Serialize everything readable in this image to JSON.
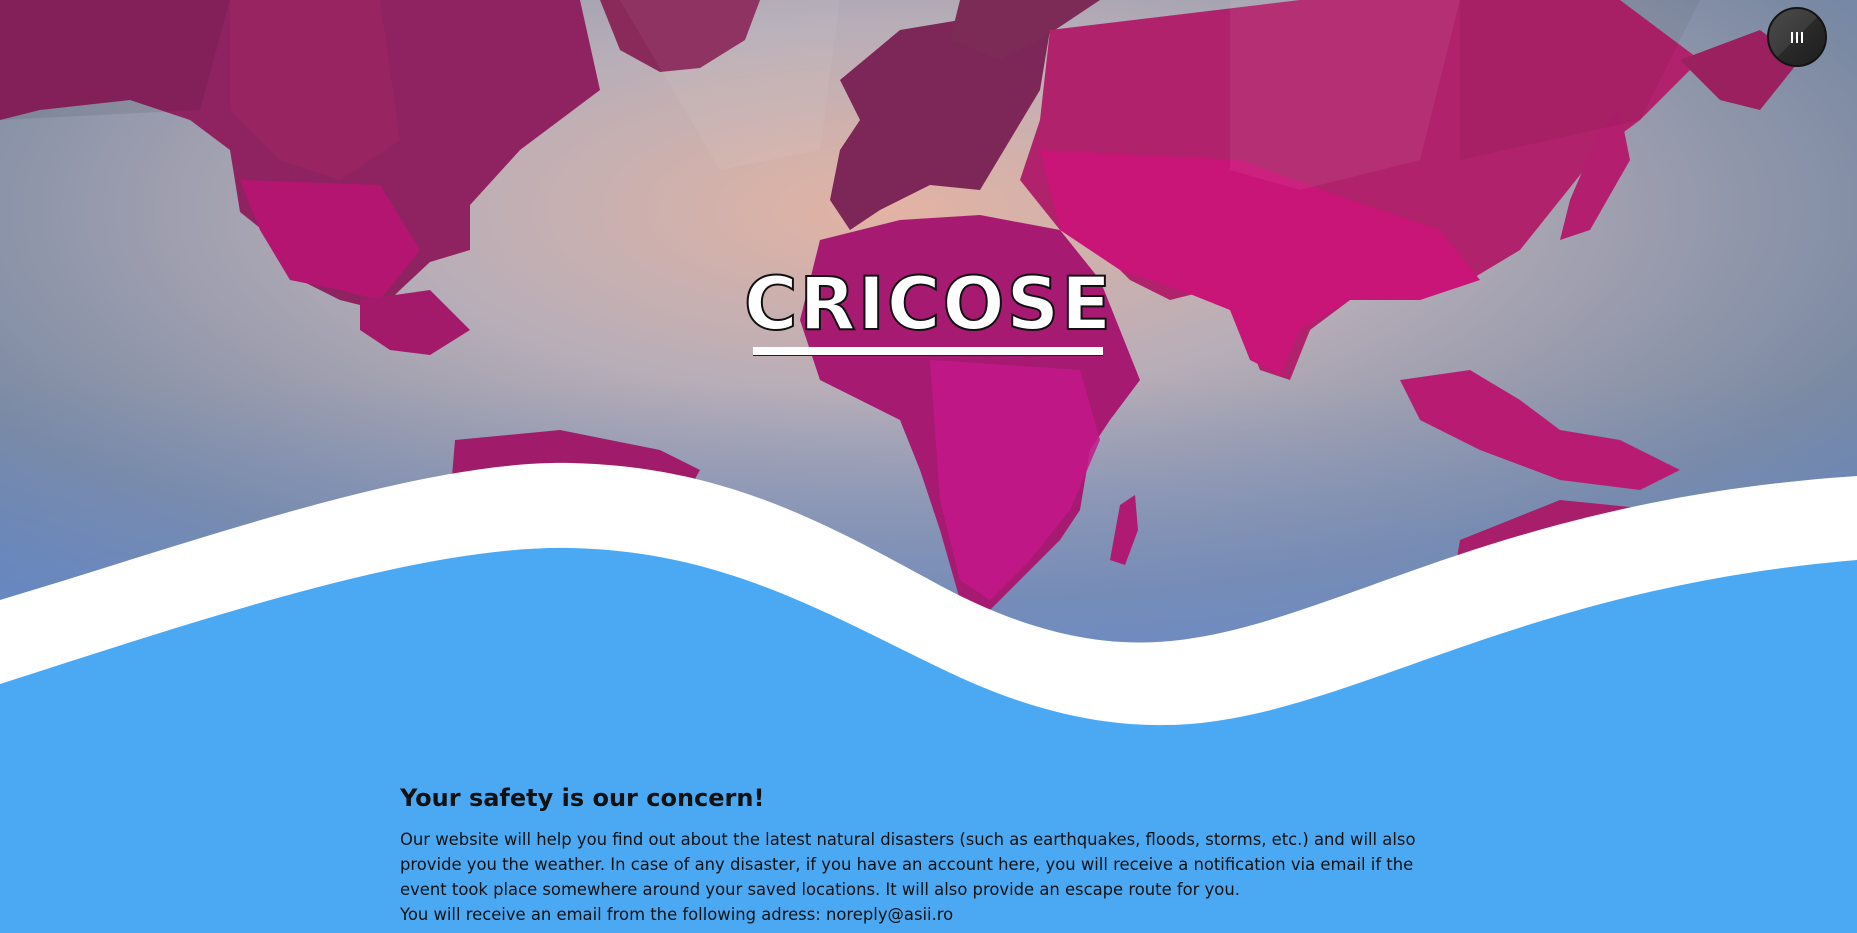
{
  "hero": {
    "title": "CRICOSE"
  },
  "menu": {
    "icon": "hamburger-vertical-icon"
  },
  "colors": {
    "section_bg": "#4ba9f3",
    "wave": "#ffffff",
    "map_land": "#c0186f",
    "map_ocean": "#b7b7c3",
    "menu_button": "#333333"
  },
  "content": {
    "heading": "Your safety is our concern!",
    "paragraph": "Our website will help you find out about the latest natural disasters (such as earthquakes, floods, storms, etc.) and will also provide you the weather. In case of any disaster, if you have an account here, you will receive a notification via email if the event took place somewhere around your saved locations. It will also provide an escape route for you.",
    "email_line": "You will receive an email from the following adress: noreply@asii.ro"
  }
}
